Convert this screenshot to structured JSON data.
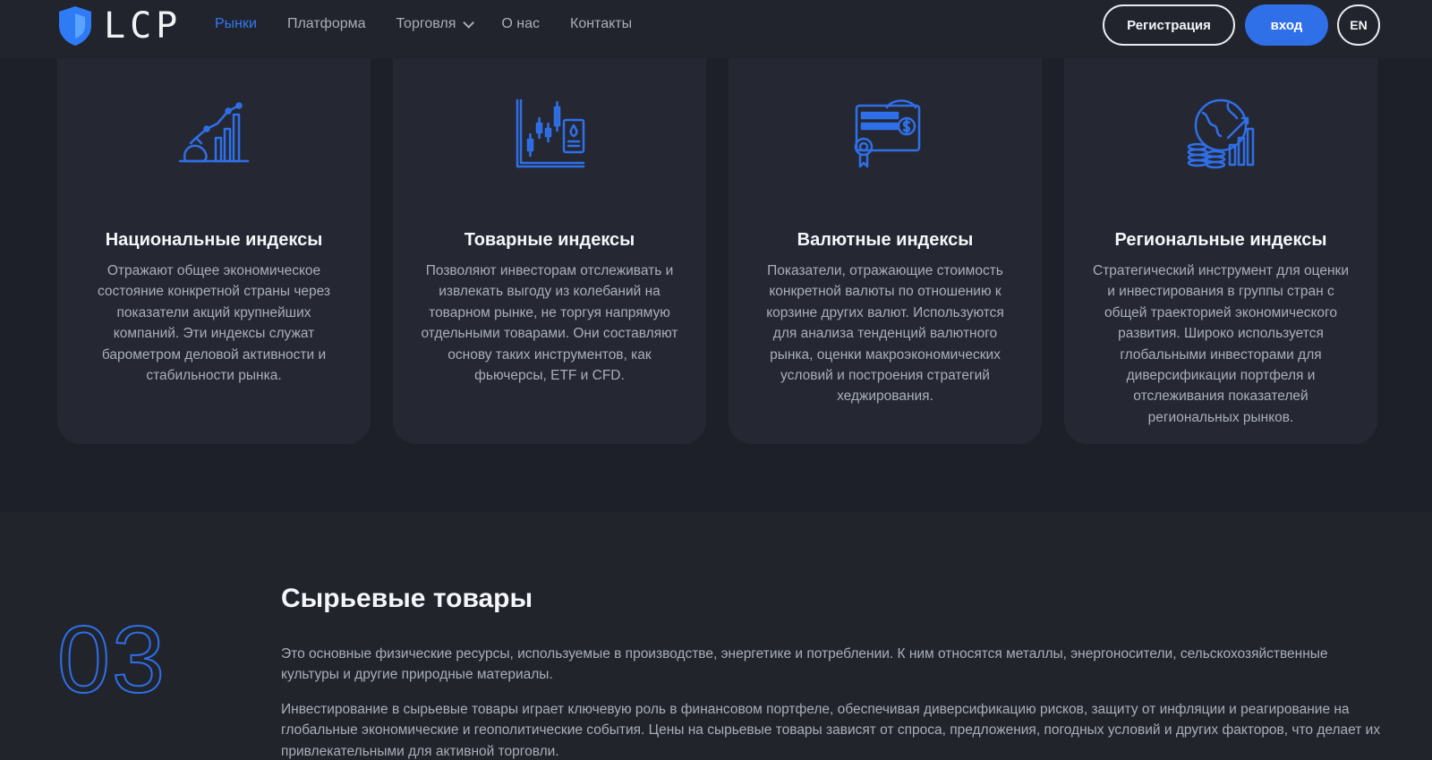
{
  "brand": {
    "name": "LCP",
    "accent": "#2f6fe8"
  },
  "nav": {
    "items": [
      {
        "label": "Рынки",
        "active": true
      },
      {
        "label": "Платформа"
      },
      {
        "label": "Торговля"
      },
      {
        "label": "О нас"
      },
      {
        "label": "Контакты"
      }
    ]
  },
  "header": {
    "register_label": "Регистрация",
    "login_label": "вход",
    "lang_label": "EN"
  },
  "cards": [
    {
      "icon": "chart-growth-icon",
      "title": "Национальные индексы",
      "text": "Отражают общее экономическое состояние конкретной страны через показатели акций крупнейших компаний. Эти индексы служат барометром деловой активности и стабильности рынка."
    },
    {
      "icon": "candlestick-chart-icon",
      "title": "Товарные индексы",
      "text": "Позволяют инвесторам отслеживать и извлекать выгоду из колебаний на товарном рынке, не торгуя напрямую отдельными товарами. Они составляют основу таких инструментов, как фьючерсы, ETF и CFD."
    },
    {
      "icon": "currency-certificate-icon",
      "title": "Валютные индексы",
      "text": "Показатели, отражающие стоимость конкретной валюты по отношению к корзине других валют. Используются для анализа тенденций валютного рынка, оценки макроэкономических условий и построения стратегий хеджирования."
    },
    {
      "icon": "globe-coins-icon",
      "title": "Региональные индексы",
      "text": "Стратегический инструмент для оценки и инвестирования в группы стран с общей траекторией экономического развития. Широко используется глобальными инвесторами для диверсификации портфеля и отслеживания показателей региональных рынков."
    }
  ],
  "section": {
    "number": "03",
    "title": "Сырьевые товары",
    "paragraph1": "Это основные физические ресурсы, используемые в производстве, энергетике и потреблении. К ним относятся металлы, энергоносители, сельскохозяйственные культуры и другие природные материалы.",
    "paragraph2": "Инвестирование в сырьевые товары играет ключевую роль в финансовом портфеле, обеспечивая диверсификацию рисков, защиту от инфляции и реагирование на глобальные экономические и геополитические события. Цены на сырьевые товары зависят от спроса, предложения, погодных условий и других факторов, что делает их привлекательными для активной торговли."
  }
}
